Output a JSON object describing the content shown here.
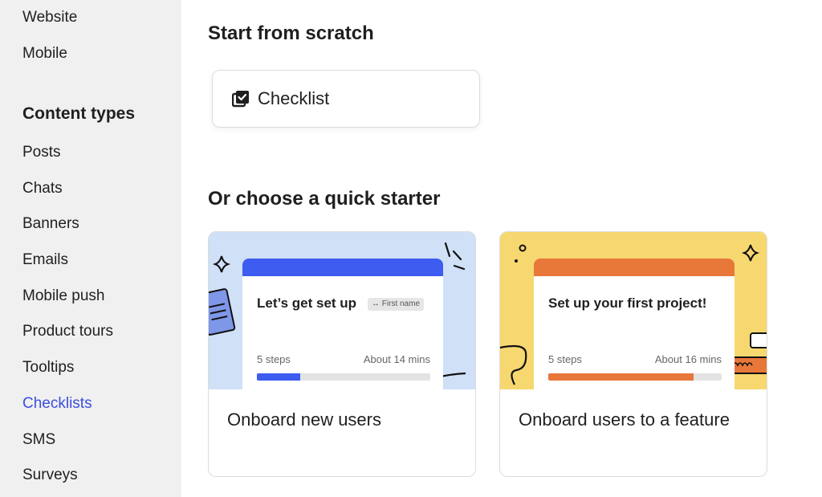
{
  "sidebar": {
    "items_top": [
      {
        "label": "Website"
      },
      {
        "label": "Mobile"
      }
    ],
    "heading": "Content types",
    "items": [
      {
        "label": "Posts"
      },
      {
        "label": "Chats"
      },
      {
        "label": "Banners"
      },
      {
        "label": "Emails"
      },
      {
        "label": "Mobile push"
      },
      {
        "label": "Product tours"
      },
      {
        "label": "Tooltips"
      },
      {
        "label": "Checklists",
        "active": true
      },
      {
        "label": "SMS"
      },
      {
        "label": "Surveys"
      }
    ]
  },
  "main": {
    "scratch_title": "Start from scratch",
    "scratch_card": {
      "label": "Checklist",
      "icon": "checklist-icon"
    },
    "starter_title": "Or choose a quick starter",
    "starters": [
      {
        "label": "Onboard new users",
        "bg_color": "#cfe0f7",
        "accent_color": "#3e5cf0",
        "preview_title": "Let’s get set up",
        "preview_pill": "First name",
        "preview_steps": "5 steps",
        "preview_time": "About 14 mins",
        "progress": 0.25
      },
      {
        "label": "Onboard users to a feature",
        "bg_color": "#f7d870",
        "accent_color": "#e8773a",
        "preview_title": "Set up your first project!",
        "preview_steps": "5 steps",
        "preview_time": "About 16 mins",
        "progress": 0.84
      }
    ]
  },
  "colors": {
    "sidebar_bg": "#f0f0f0",
    "active_link": "#3b4ee0"
  }
}
